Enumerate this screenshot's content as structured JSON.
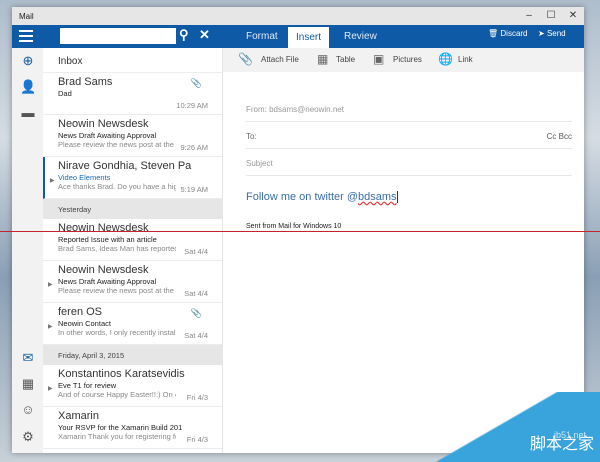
{
  "window": {
    "title": "Mail",
    "minimize": "–",
    "maximize": "☐",
    "close": "✕"
  },
  "header": {
    "search_placeholder": "",
    "search_icon": "⚲",
    "clear_icon": "✕",
    "tabs": [
      "Format",
      "Insert",
      "Review"
    ],
    "active_tab": "Insert",
    "discard": "Discard",
    "send": "Send"
  },
  "toolbar": {
    "attach": "Attach File",
    "table": "Table",
    "pictures": "Pictures",
    "link": "Link"
  },
  "list": {
    "title": "Inbox",
    "groups": {
      "yesterday": "Yesterday",
      "friday": "Friday, April 3, 2015"
    },
    "items": [
      {
        "name": "Brad Sams",
        "subject": "Dad",
        "preview": "",
        "time": "10:29 AM"
      },
      {
        "name": "Neowin Newsdesk",
        "subject": "News Draft Awaiting Approval",
        "preview": "Please review the news post at the",
        "time": "9:26 AM"
      },
      {
        "name": "Nirave Gondhia, Steven Pa",
        "subject": "Video Elements",
        "preview": "Ace thanks Brad. Do you have a hig",
        "time": "5:19 AM"
      },
      {
        "name": "Neowin Newsdesk",
        "subject": "Reported Issue with an article",
        "preview": "Brad Sams, Ideas Man has reported",
        "time": "Sat 4/4"
      },
      {
        "name": "Neowin Newsdesk",
        "subject": "News Draft Awaiting Approval",
        "preview": "Please review the news post at the t",
        "time": "Sat 4/4"
      },
      {
        "name": "feren OS",
        "subject": "Neowin Contact",
        "preview": "In other words, I only recently instal",
        "time": "Sat 4/4"
      },
      {
        "name": "Konstantinos Karatsevidis",
        "subject": "Eve T1 for review",
        "preview": "And of course Happy Easter!!:) On 4",
        "time": "Fri 4/3"
      },
      {
        "name": "Xamarin",
        "subject": "Your RSVP for the Xamarin Build 201",
        "preview": "Xamarin Thank you for registering fc",
        "time": "Fri 4/3"
      }
    ]
  },
  "compose": {
    "from": "From:  bdsams@neowin.net",
    "to": "To:",
    "ccbcc": "Cc Bcc",
    "subject_placeholder": "Subject",
    "body_text": "Follow me on twitter @",
    "body_handle": "bdsams",
    "signature": "Sent from Mail for Windows 10"
  },
  "watermark": {
    "site": "jb51.net",
    "name": "脚本之家"
  },
  "colors": {
    "accent": "#0f5aa6"
  }
}
